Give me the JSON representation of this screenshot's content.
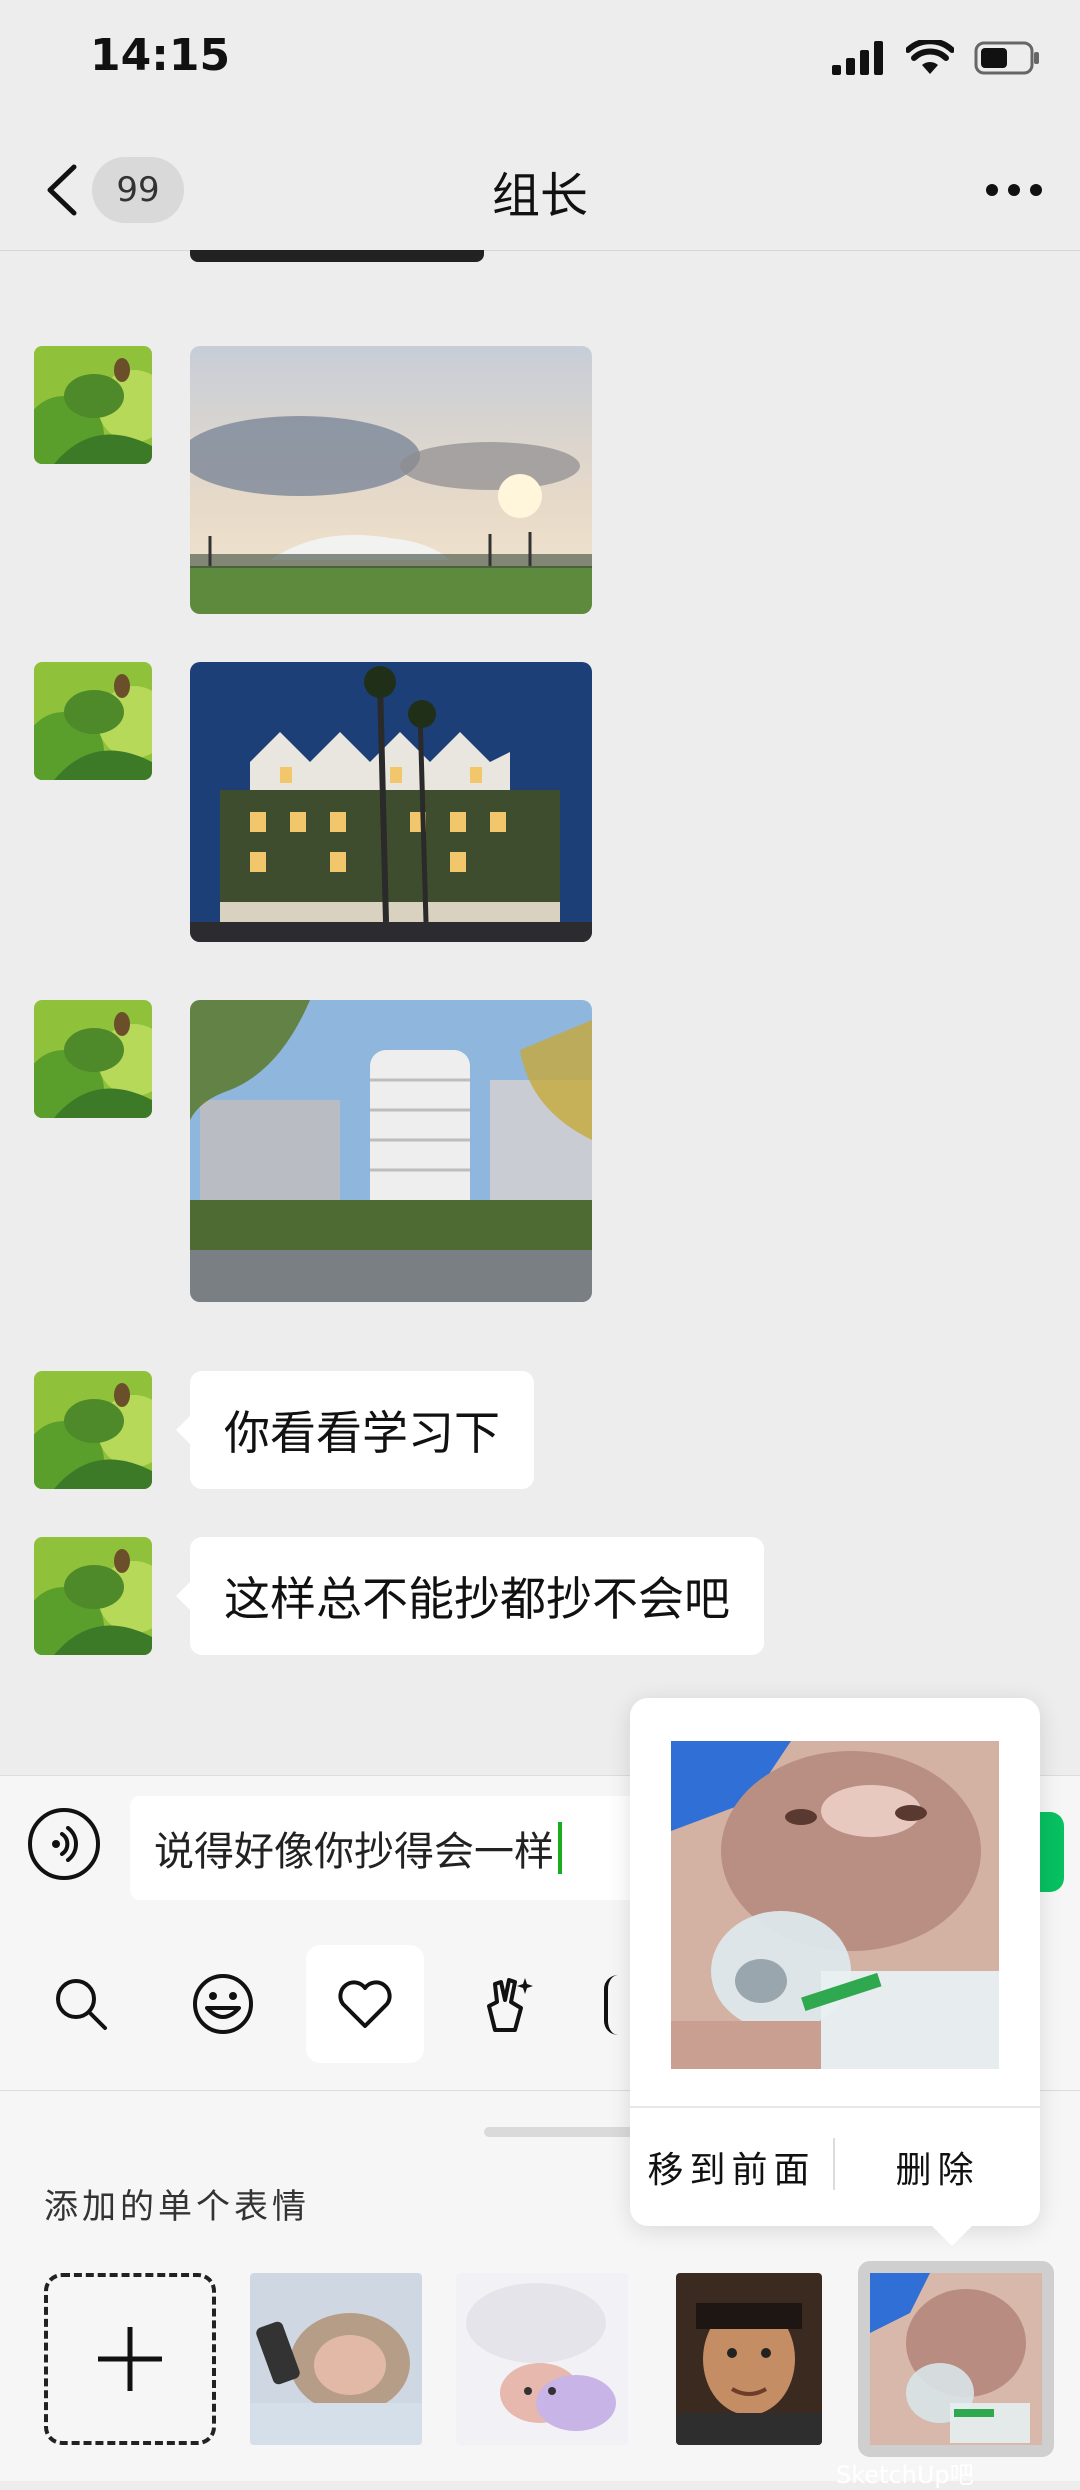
{
  "status_bar": {
    "time": "14:15"
  },
  "nav": {
    "unread_count": "99",
    "title": "组长"
  },
  "messages": [
    {
      "type": "text",
      "text": "你看看学习下"
    },
    {
      "type": "text",
      "text": "这样总不能抄都抄不会吧"
    }
  ],
  "input": {
    "value": "说得好像你抄得会一样"
  },
  "sticker_panel": {
    "section_title": "添加的单个表情"
  },
  "popup": {
    "move_front": "移到前面",
    "delete": "删除"
  },
  "watermark": {
    "brand": "SketchUp吧"
  },
  "colors": {
    "accent_green": "#07c160",
    "bubble": "#ffffff",
    "background": "#ededed"
  },
  "icons": [
    "back-chevron",
    "more-dots",
    "voice",
    "search",
    "emoji-face",
    "heart",
    "hand-gesture",
    "plus"
  ]
}
